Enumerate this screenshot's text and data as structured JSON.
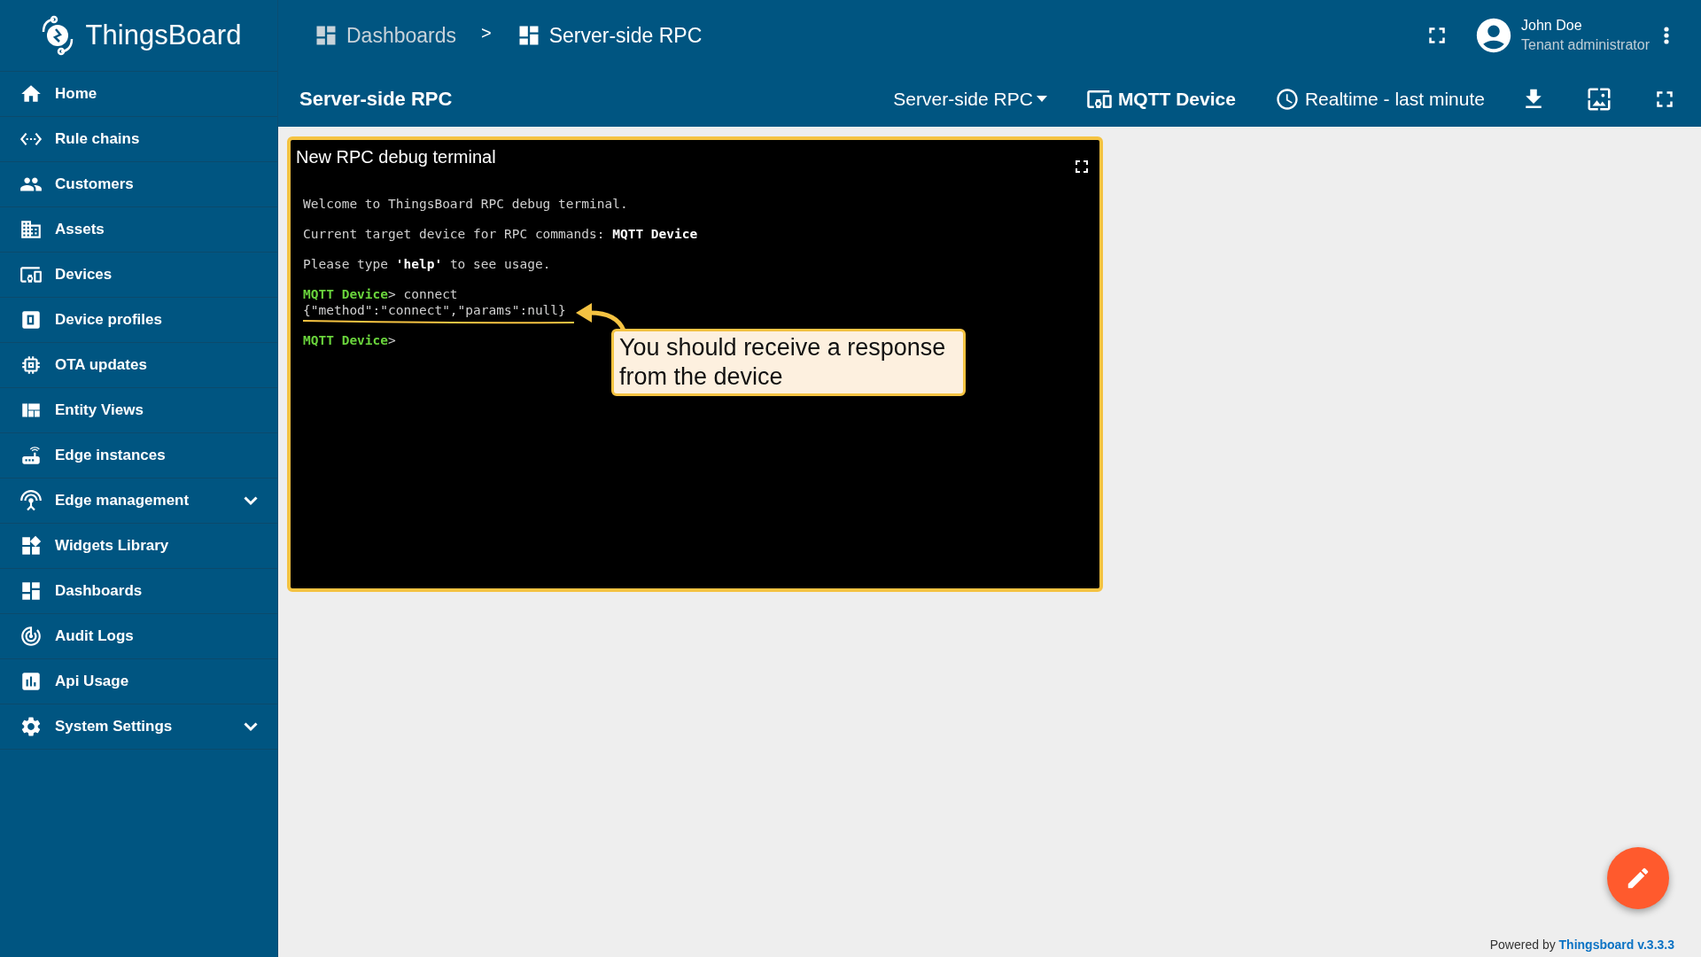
{
  "logo": {
    "text": "ThingsBoard"
  },
  "breadcrumbs": [
    {
      "label": "Dashboards",
      "selected": false
    },
    {
      "label": "Server-side RPC",
      "selected": true
    }
  ],
  "breadcrumb_separator": ">",
  "user": {
    "name": "John Doe",
    "role": "Tenant administrator"
  },
  "sidebar": {
    "items": [
      {
        "label": "Home",
        "expandable": false
      },
      {
        "label": "Rule chains",
        "expandable": false
      },
      {
        "label": "Customers",
        "expandable": false
      },
      {
        "label": "Assets",
        "expandable": false
      },
      {
        "label": "Devices",
        "expandable": false
      },
      {
        "label": "Device profiles",
        "expandable": false
      },
      {
        "label": "OTA updates",
        "expandable": false
      },
      {
        "label": "Entity Views",
        "expandable": false
      },
      {
        "label": "Edge instances",
        "expandable": false
      },
      {
        "label": "Edge management",
        "expandable": true
      },
      {
        "label": "Widgets Library",
        "expandable": false
      },
      {
        "label": "Dashboards",
        "expandable": false
      },
      {
        "label": "Audit Logs",
        "expandable": false
      },
      {
        "label": "Api Usage",
        "expandable": false
      },
      {
        "label": "System Settings",
        "expandable": true
      }
    ]
  },
  "toolbar": {
    "title": "Server-side RPC",
    "state": "Server-side RPC",
    "entity": "MQTT Device",
    "timewindow": "Realtime - last minute"
  },
  "widget": {
    "title": "New RPC debug terminal",
    "lines": [
      {
        "segments": [
          {
            "kind": "plain",
            "text": "Welcome to ThingsBoard RPC debug terminal."
          }
        ]
      },
      {
        "segments": [
          {
            "kind": "plain",
            "text": "Current target device for RPC commands: "
          },
          {
            "kind": "bold",
            "text": "MQTT Device"
          }
        ]
      },
      {
        "segments": [
          {
            "kind": "plain",
            "text": "Please type "
          },
          {
            "kind": "bold",
            "text": "'help'"
          },
          {
            "kind": "plain",
            "text": " to see usage."
          }
        ]
      },
      {
        "segments": [
          {
            "kind": "prompt",
            "text": "MQTT Device"
          },
          {
            "kind": "plain",
            "text": "> connect"
          }
        ]
      },
      {
        "segments": [
          {
            "kind": "plain",
            "text": "{\"method\":\"connect\",\"params\":null}"
          }
        ],
        "attached": true
      },
      {
        "segments": [
          {
            "kind": "prompt",
            "text": "MQTT Device"
          },
          {
            "kind": "plain",
            "text": ">"
          }
        ]
      }
    ]
  },
  "callout": {
    "text": "You should receive a response from the device"
  },
  "footer": {
    "prefix": "Powered by",
    "link": "Thingsboard v.3.3.3"
  }
}
